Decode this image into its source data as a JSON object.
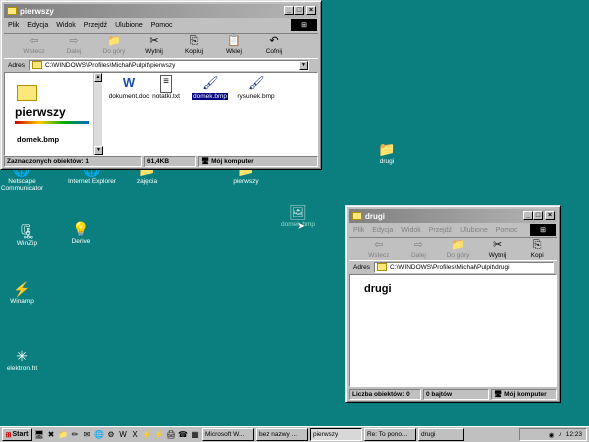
{
  "desktop": {
    "icons": [
      {
        "label": "Netscape Communicator",
        "glyph": "🌐"
      },
      {
        "label": "Internet Explorer",
        "glyph": "🌐"
      },
      {
        "label": "zajęcia",
        "glyph": "📁"
      },
      {
        "label": "pierwszy",
        "glyph": "📁"
      },
      {
        "label": "drugi",
        "glyph": "📁"
      },
      {
        "label": "WinZip",
        "glyph": "🗜"
      },
      {
        "label": "Derive",
        "glyph": "💡"
      },
      {
        "label": "domek.bmp",
        "glyph": "🖼"
      },
      {
        "label": "Winamp",
        "glyph": "⚡"
      },
      {
        "label": "elektron.ht",
        "glyph": "✳"
      }
    ]
  },
  "window1": {
    "title": "pierwszy",
    "menu": [
      "Plik",
      "Edycja",
      "Widok",
      "Przejdź",
      "Ulubione",
      "Pomoc"
    ],
    "toolbar": [
      {
        "label": "Wstecz",
        "glyph": "⇦",
        "disabled": true
      },
      {
        "label": "Dalej",
        "glyph": "⇨",
        "disabled": true
      },
      {
        "label": "Do góry",
        "glyph": "📁",
        "disabled": true
      },
      {
        "label": "Wytnij",
        "glyph": "✂",
        "disabled": false
      },
      {
        "label": "Kopiuj",
        "glyph": "⎘",
        "disabled": false
      },
      {
        "label": "Wklej",
        "glyph": "📋",
        "disabled": false
      },
      {
        "label": "Cofnij",
        "glyph": "↶",
        "disabled": false
      }
    ],
    "address_label": "Adres",
    "address": "C:\\WINDOWS\\Profiles\\Michał\\Pulpit\\pierwszy",
    "panel_title": "pierwszy",
    "panel_selected": "domek.bmp",
    "files": [
      {
        "name": "dokument.doc",
        "glyph": "W"
      },
      {
        "name": "notatki.txt",
        "glyph": "≡"
      },
      {
        "name": "domek.bmp",
        "glyph": "🖌"
      },
      {
        "name": "rysunek.bmp",
        "glyph": "🖌"
      }
    ],
    "selected_file": "domek.bmp",
    "status": {
      "left": "Zaznaczonych obiektów: 1",
      "size": "61,4KB",
      "zone": "Mój komputer"
    }
  },
  "window2": {
    "title": "drugi",
    "menu": [
      "Plik",
      "Edycja",
      "Widok",
      "Przejdź",
      "Ulubione",
      "Pomoc"
    ],
    "toolbar": [
      {
        "label": "Wstecz",
        "glyph": "⇦",
        "disabled": true
      },
      {
        "label": "Dalej",
        "glyph": "⇨",
        "disabled": true
      },
      {
        "label": "Do góry",
        "glyph": "📁",
        "disabled": true
      },
      {
        "label": "Wytnij",
        "glyph": "✂",
        "disabled": false
      },
      {
        "label": "Kopi",
        "glyph": "⎘",
        "disabled": false
      }
    ],
    "address_label": "Adres",
    "address": "C:\\WINDOWS\\Profiles\\Michał\\Pulpit\\drugi",
    "panel_title": "drugi",
    "status": {
      "left": "Liczba obiektów: 0",
      "size": "0 bajtów",
      "zone": "Mój komputer"
    }
  },
  "taskbar": {
    "start_label": "Start",
    "tasks": [
      {
        "label": "Microsoft W...",
        "pressed": false
      },
      {
        "label": "bez nazwy ...",
        "pressed": false
      },
      {
        "label": "pierwszy",
        "pressed": true
      },
      {
        "label": "Re: To pono...",
        "pressed": false
      },
      {
        "label": "drugi",
        "pressed": false
      }
    ],
    "clock": "12:23"
  },
  "colors": {
    "desktop": "#0b7f7f",
    "title_active": "#000080",
    "title_inactive": "#808080"
  }
}
